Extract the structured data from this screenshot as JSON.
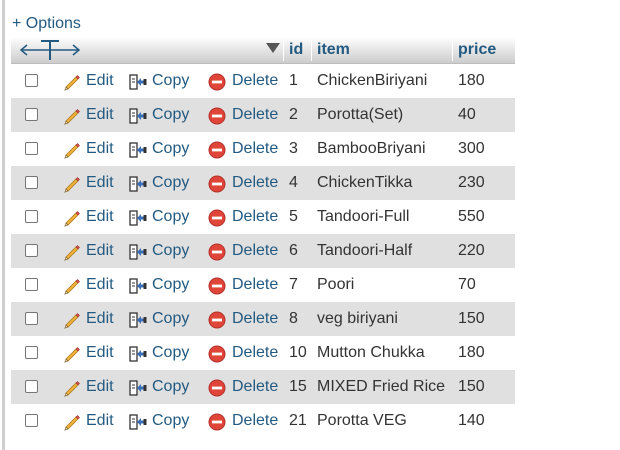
{
  "options_label": "+ Options",
  "columns": {
    "id": "id",
    "item": "item",
    "price": "price"
  },
  "actions": {
    "edit": "Edit",
    "copy": "Copy",
    "delete": "Delete"
  },
  "rows": [
    {
      "id": "1",
      "item": "ChickenBiriyani",
      "price": "180"
    },
    {
      "id": "2",
      "item": "Porotta(Set)",
      "price": "40"
    },
    {
      "id": "3",
      "item": "BambooBriyani",
      "price": "300"
    },
    {
      "id": "4",
      "item": "ChickenTikka",
      "price": "230"
    },
    {
      "id": "5",
      "item": "Tandoori-Full",
      "price": "550"
    },
    {
      "id": "6",
      "item": "Tandoori-Half",
      "price": "220"
    },
    {
      "id": "7",
      "item": "Poori",
      "price": "70"
    },
    {
      "id": "8",
      "item": "veg biriyani",
      "price": "150"
    },
    {
      "id": "10",
      "item": "Mutton Chukka",
      "price": "180"
    },
    {
      "id": "15",
      "item": "MIXED Fried Rice",
      "price": "150"
    },
    {
      "id": "21",
      "item": "Porotta VEG",
      "price": "140"
    }
  ],
  "colors": {
    "link": "#235a81",
    "text": "#333333",
    "row_alt": "#e0e0e0",
    "delete_red": "#e0453a",
    "pencil": "#e8a436"
  },
  "icons": {
    "edit": "pencil-icon",
    "copy": "copy-icon",
    "delete": "delete-icon",
    "columns": "column-resize-icon",
    "sort": "sort-caret-icon"
  }
}
